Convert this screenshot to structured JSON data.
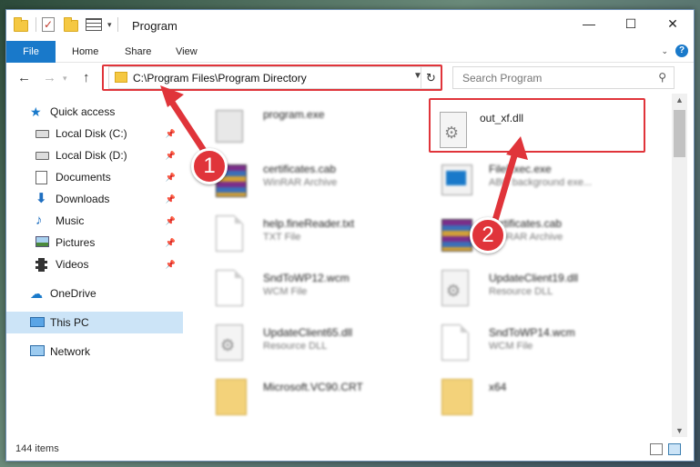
{
  "window": {
    "title": "Program"
  },
  "ribbon": {
    "tabs": [
      "File",
      "Home",
      "Share",
      "View"
    ],
    "help": "?"
  },
  "nav": {
    "back": "←",
    "forward": "→",
    "up": "↑",
    "address": "C:\\Program Files\\Program Directory",
    "refresh": "↻",
    "search_placeholder": "Search Program"
  },
  "sidebar": {
    "items": [
      {
        "label": "Quick access",
        "icon": "star-icon"
      },
      {
        "label": "Local Disk (C:)",
        "icon": "drive-icon",
        "pinned": true
      },
      {
        "label": "Local Disk (D:)",
        "icon": "drive-icon",
        "pinned": true
      },
      {
        "label": "Documents",
        "icon": "documents-icon",
        "pinned": true
      },
      {
        "label": "Downloads",
        "icon": "downloads-icon",
        "pinned": true
      },
      {
        "label": "Music",
        "icon": "music-icon",
        "pinned": true
      },
      {
        "label": "Pictures",
        "icon": "pictures-icon",
        "pinned": true
      },
      {
        "label": "Videos",
        "icon": "videos-icon",
        "pinned": true
      },
      {
        "label": "OneDrive",
        "icon": "onedrive-icon"
      },
      {
        "label": "This PC",
        "icon": "pc-icon",
        "selected": true
      },
      {
        "label": "Network",
        "icon": "network-icon"
      }
    ]
  },
  "files": [
    {
      "name": "program.exe",
      "type": "",
      "icon": "program-icon"
    },
    {
      "name": "out_xf.dll",
      "type": "",
      "icon": "dll-icon"
    },
    {
      "name": "certificates.cab",
      "type": "WinRAR Archive",
      "icon": "rar-icon"
    },
    {
      "name": "FileExec.exe",
      "type": "ABC background exe...",
      "icon": "exe-icon"
    },
    {
      "name": "help.fineReader.txt",
      "type": "TXT File",
      "icon": "txt-icon"
    },
    {
      "name": "certificates.cab",
      "type": "WinRAR Archive",
      "icon": "rar-icon"
    },
    {
      "name": "SndToWP12.wcm",
      "type": "WCM File",
      "icon": "txt-icon"
    },
    {
      "name": "UpdateClient19.dll",
      "type": "Resource DLL",
      "icon": "dll-icon"
    },
    {
      "name": "UpdateClient65.dll",
      "type": "Resource DLL",
      "icon": "dll-icon"
    },
    {
      "name": "SndToWP14.wcm",
      "type": "WCM File",
      "icon": "txt-icon"
    },
    {
      "name": "Microsoft.VC90.CRT",
      "type": "",
      "icon": "folder-icon"
    },
    {
      "name": "x64",
      "type": "",
      "icon": "folder-icon"
    }
  ],
  "annotations": {
    "step1": "1",
    "step2": "2",
    "color": "#e0343a"
  },
  "status": {
    "items": "144 items"
  },
  "colors": {
    "accent": "#1979ca",
    "selection": "#cce4f7",
    "highlight": "#e0343a"
  }
}
